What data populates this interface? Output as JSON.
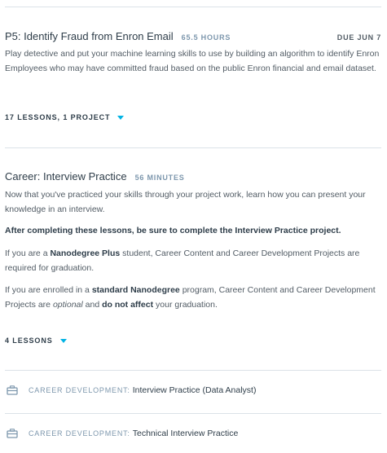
{
  "p5": {
    "title": "P5: Identify Fraud from Enron Email",
    "duration": "65.5 HOURS",
    "due": "DUE JUN 7",
    "description": "Play detective and put your machine learning skills to use by building an algorithm to identify Enron Employees who may have committed fraud based on the public Enron financial and email dataset.",
    "meta": "17 LESSONS, 1 PROJECT"
  },
  "career": {
    "title": "Career: Interview Practice",
    "duration": "56 MINUTES",
    "p1": "Now that you've practiced your skills through your project work, learn how you can present your knowledge in an interview.",
    "p2": "After completing these lessons, be sure to complete the Interview Practice project.",
    "p3_a": "If you are a ",
    "p3_b": "Nanodegree Plus",
    "p3_c": " student, Career Content and Career Development Projects are required for graduation.",
    "p4_a": "If you are enrolled in a ",
    "p4_b": "standard Nanodegree",
    "p4_c": " program, Career Content and Career Development Projects are ",
    "p4_d": "optional",
    "p4_e": " and ",
    "p4_f": "do not affect",
    "p4_g": " your graduation.",
    "meta": "4 LESSONS"
  },
  "career_items": [
    {
      "label": "CAREER DEVELOPMENT:",
      "title": "Interview Practice (Data Analyst)",
      "icon": "briefcase-icon"
    },
    {
      "label": "CAREER DEVELOPMENT:",
      "title": "Technical Interview Practice",
      "icon": "briefcase-icon"
    }
  ],
  "colors": {
    "accent": "#02b3e4",
    "text": "#2e3d49",
    "muted": "#7d97ad",
    "divider": "#dbe2e8"
  }
}
